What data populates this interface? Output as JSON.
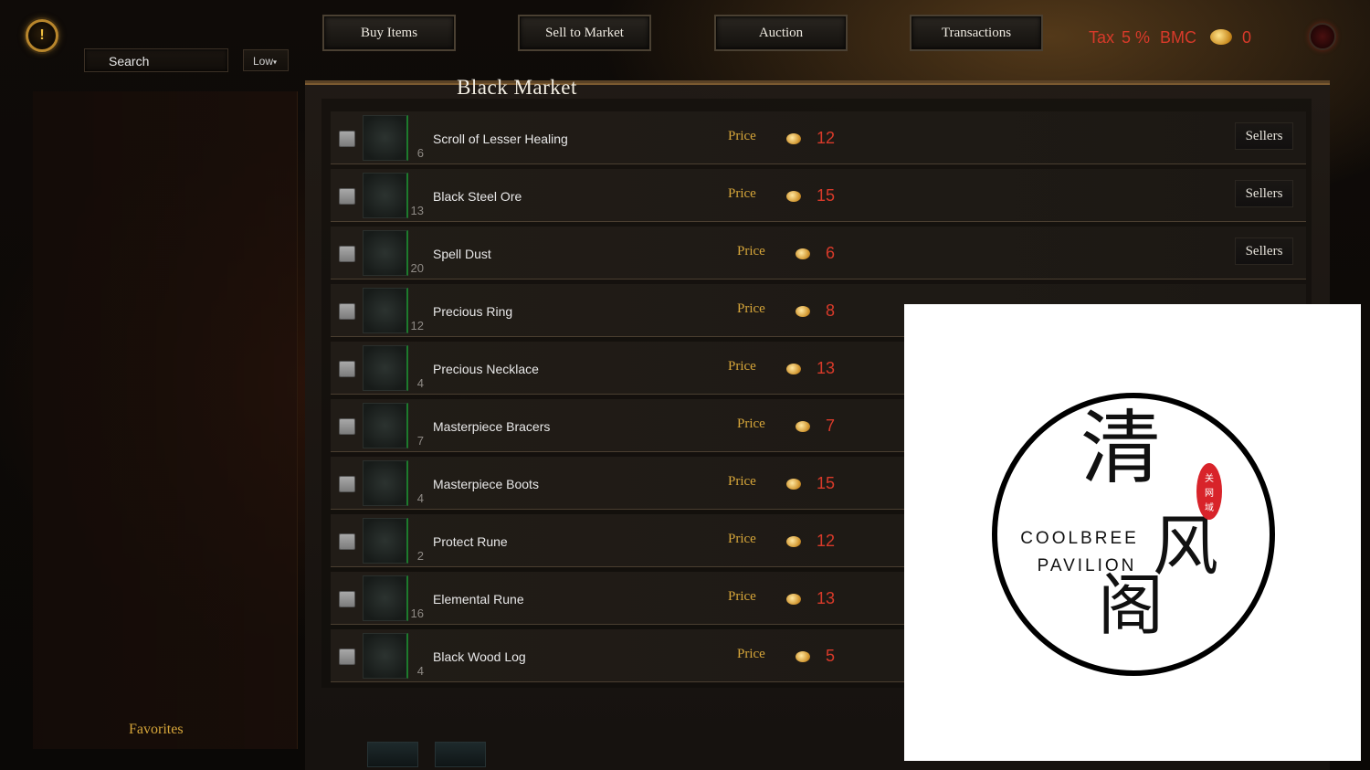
{
  "header": {
    "search": {
      "placeholder": "Search",
      "value": ""
    },
    "sort": {
      "selected": "Low"
    },
    "nav": [
      "Buy Items",
      "Sell to Market",
      "Auction",
      "Transactions"
    ],
    "tax": {
      "label": "Tax",
      "value": "5 %"
    },
    "currency": {
      "label": "BMC",
      "value": "0"
    }
  },
  "sidebar": {
    "favorites_label": "Favorites"
  },
  "market": {
    "title": "Black Market",
    "price_label": "Price",
    "sellers_label": "Sellers",
    "items": [
      {
        "name": "Scroll of Lesser Healing",
        "qty": "6",
        "price": "12",
        "icon": "scroll-icon"
      },
      {
        "name": "Black Steel Ore",
        "qty": "13",
        "price": "15",
        "icon": "ore-icon"
      },
      {
        "name": "Spell Dust",
        "qty": "20",
        "price": "6",
        "icon": "dust-icon"
      },
      {
        "name": "Precious Ring",
        "qty": "12",
        "price": "8",
        "icon": "ring-icon"
      },
      {
        "name": "Precious Necklace",
        "qty": "4",
        "price": "13",
        "icon": "necklace-icon"
      },
      {
        "name": "Masterpiece Bracers",
        "qty": "7",
        "price": "7",
        "icon": "bracers-icon"
      },
      {
        "name": "Masterpiece Boots",
        "qty": "4",
        "price": "15",
        "icon": "boots-icon"
      },
      {
        "name": "Protect Rune",
        "qty": "2",
        "price": "12",
        "icon": "rune-icon"
      },
      {
        "name": "Elemental Rune",
        "qty": "16",
        "price": "13",
        "icon": "orb-rune-icon"
      },
      {
        "name": "Black Wood Log",
        "qty": "4",
        "price": "5",
        "icon": "log-icon"
      }
    ]
  },
  "watermark": {
    "line1": "COOLBREE",
    "line2": "PAVILION",
    "chars": [
      "清",
      "风",
      "阁"
    ],
    "seal": [
      "关",
      "网",
      "域"
    ]
  },
  "colors": {
    "accent_gold": "#d7a63a",
    "price_red": "#d83a2a",
    "panel_dark": "#1e1a15"
  }
}
